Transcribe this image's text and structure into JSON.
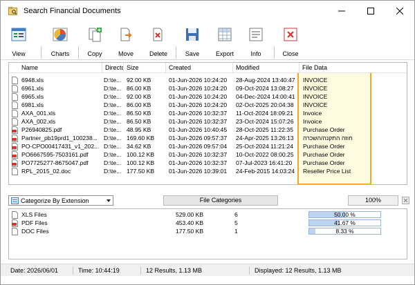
{
  "window": {
    "title": "Search Financial Documents"
  },
  "toolbar": {
    "buttons": [
      {
        "label": "View",
        "icon": "view-icon"
      },
      {
        "label": "Charts",
        "icon": "charts-icon"
      },
      {
        "label": "Copy",
        "icon": "copy-icon"
      },
      {
        "label": "Move",
        "icon": "move-icon"
      },
      {
        "label": "Delete",
        "icon": "delete-icon"
      },
      {
        "label": "Save",
        "icon": "save-icon"
      },
      {
        "label": "Export",
        "icon": "export-icon"
      },
      {
        "label": "Info",
        "icon": "info-icon"
      },
      {
        "label": "Close",
        "icon": "close-icon"
      }
    ]
  },
  "results": {
    "columns": [
      "Name",
      "Directory",
      "Size",
      "Created",
      "Modified",
      "File Data"
    ],
    "rows": [
      {
        "name": "6948.xls",
        "dir": "D:\\te...",
        "size": "92.00 KB",
        "created": "01-Jun-2026 10:24:20",
        "modified": "28-Aug-2024 13:40:47",
        "data": "INVOICE",
        "type": "xls"
      },
      {
        "name": "6961.xls",
        "dir": "D:\\te...",
        "size": "86.00 KB",
        "created": "01-Jun-2026 10:24:20",
        "modified": "09-Oct-2024 13:08:27",
        "data": "INVOICE",
        "type": "xls"
      },
      {
        "name": "6965.xls",
        "dir": "D:\\te...",
        "size": "92.00 KB",
        "created": "01-Jun-2026 10:24:20",
        "modified": "04-Dec-2024 14:00:41",
        "data": "INVOICE",
        "type": "xls"
      },
      {
        "name": "6981.xls",
        "dir": "D:\\te...",
        "size": "86.00 KB",
        "created": "01-Jun-2026 10:24:20",
        "modified": "02-Oct-2025 20:04:38",
        "data": "INVOICE",
        "type": "xls"
      },
      {
        "name": "AXA_001.xls",
        "dir": "D:\\te...",
        "size": "86.50 KB",
        "created": "01-Jun-2026 10:32:37",
        "modified": "11-Oct-2024 18:09:21",
        "data": "Invoice",
        "type": "xls"
      },
      {
        "name": "AXA_002.xls",
        "dir": "D:\\te...",
        "size": "86.50 KB",
        "created": "01-Jun-2026 10:32:37",
        "modified": "23-Oct-2024 15:07:26",
        "data": "Invoice",
        "type": "xls"
      },
      {
        "name": "P26940825.pdf",
        "dir": "D:\\te...",
        "size": "48.95 KB",
        "created": "01-Jun-2026 10:40:45",
        "modified": "28-Oct-2025 11:22:35",
        "data": "Purchase Order",
        "type": "pdf"
      },
      {
        "name": "Partner_pb19prd1_100238...",
        "dir": "D:\\te...",
        "size": "169.60 KB",
        "created": "01-Jun-2026 09:57:37",
        "modified": "24-Apr-2025 13:26:13",
        "data": "חוזה התקנה/השכרה",
        "type": "pdf"
      },
      {
        "name": "PO-CPO00417431_v1_202...",
        "dir": "D:\\te...",
        "size": "34.62 KB",
        "created": "01-Jun-2026 09:57:04",
        "modified": "25-Oct-2024 11:21:24",
        "data": "Purchase Order",
        "type": "pdf"
      },
      {
        "name": "PO6667595-7503161.pdf",
        "dir": "D:\\te...",
        "size": "100.12 KB",
        "created": "01-Jun-2026 10:32:37",
        "modified": "10-Oct-2022 08:00:25",
        "data": "Purchase Order",
        "type": "pdf"
      },
      {
        "name": "PO7725277-8675047.pdf",
        "dir": "D:\\te...",
        "size": "100.12 KB",
        "created": "01-Jun-2026 10:32:37",
        "modified": "07-Jul-2023 16:41:20",
        "data": "Purchase Order",
        "type": "pdf"
      },
      {
        "name": "RPL_2015_02.doc",
        "dir": "D:\\te...",
        "size": "177.50 KB",
        "created": "01-Jun-2026 10:39:01",
        "modified": "24-Feb-2015 14:03:24",
        "data": "Reseller Price List",
        "type": "doc"
      }
    ]
  },
  "categories": {
    "combo_value": "Categorize By Extension",
    "button_label": "File Categories",
    "percent_label": "100%",
    "rows": [
      {
        "name": "XLS Files",
        "size": "529.00 KB",
        "count": "6",
        "percent_text": "50.00 %",
        "percent": 50.0,
        "type": "xls"
      },
      {
        "name": "PDF Files",
        "size": "453.40 KB",
        "count": "5",
        "percent_text": "41.67 %",
        "percent": 41.67,
        "type": "pdf"
      },
      {
        "name": "DOC Files",
        "size": "177.50 KB",
        "count": "1",
        "percent_text": "8.33 %",
        "percent": 8.33,
        "type": "doc"
      }
    ]
  },
  "status": {
    "date": "Date: 2026/06/01",
    "time": "Time: 10:44:19",
    "results": "12 Results, 1.13 MB",
    "displayed": "Displayed: 12 Results, 1.13 MB"
  },
  "colors": {
    "highlight_border": "#f5a623",
    "highlight_fill": "#fffbe0",
    "progress_fill": "#bcd4f0"
  }
}
